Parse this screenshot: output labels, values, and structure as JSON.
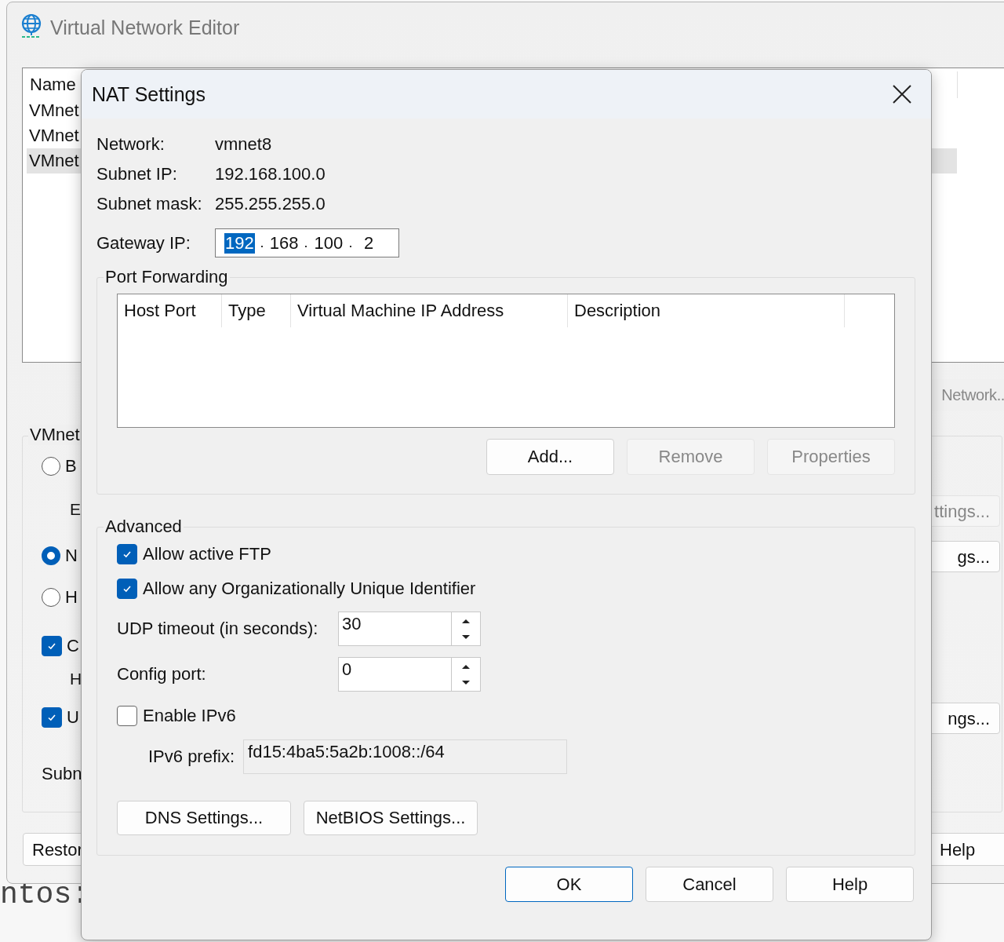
{
  "terminal_text": "ntos:",
  "background_window": {
    "title": "Virtual Network Editor",
    "network_list": {
      "column": "Name",
      "rows": [
        {
          "name": "VMnet",
          "selected": false
        },
        {
          "name": "VMnet",
          "selected": false
        },
        {
          "name": "VMnet",
          "selected": true
        }
      ]
    },
    "network_button": {
      "label": "Network..",
      "disabled": true
    },
    "group_label": "VMnet",
    "radios": [
      {
        "label": "B",
        "selected": false
      },
      {
        "label": "N",
        "selected": true
      },
      {
        "label": "H",
        "selected": false
      }
    ],
    "bridge_label": "E",
    "checkboxes": [
      {
        "label": "C",
        "checked": true
      },
      {
        "label": "U",
        "checked": true
      }
    ],
    "host_label": "H",
    "subnet_label": "Subn",
    "side_buttons": [
      {
        "label": "ttings...",
        "disabled": true
      },
      {
        "label": "gs...",
        "disabled": false
      },
      {
        "label": "ngs...",
        "disabled": false
      }
    ],
    "restore_button": "Restor",
    "help_button": "Help"
  },
  "nat_dialog": {
    "title": "NAT Settings",
    "info": [
      {
        "label": "Network:",
        "value": "vmnet8"
      },
      {
        "label": "Subnet IP:",
        "value": "192.168.100.0"
      },
      {
        "label": "Subnet mask:",
        "value": "255.255.255.0"
      }
    ],
    "gateway": {
      "label": "Gateway IP:",
      "octets": [
        {
          "value": "192",
          "selected": true
        },
        {
          "value": "168",
          "selected": false
        },
        {
          "value": "100",
          "selected": false
        },
        {
          "value": "2",
          "selected": false
        }
      ]
    },
    "port_forwarding": {
      "title": "Port Forwarding",
      "columns": [
        "Host Port",
        "Type",
        "Virtual Machine IP Address",
        "Description"
      ],
      "buttons": [
        {
          "label": "Add...",
          "disabled": false
        },
        {
          "label": "Remove",
          "disabled": true
        },
        {
          "label": "Properties",
          "disabled": true
        }
      ]
    },
    "advanced": {
      "title": "Advanced",
      "checkboxes": [
        {
          "label": "Allow active FTP",
          "checked": true
        },
        {
          "label": "Allow any Organizationally Unique Identifier",
          "checked": true
        }
      ],
      "spinners": [
        {
          "label": "UDP timeout (in seconds):",
          "value": "30"
        },
        {
          "label": "Config port:",
          "value": "0"
        }
      ],
      "ipv6": {
        "label": "Enable IPv6",
        "checked": false
      },
      "ipv6_prefix": {
        "label": "IPv6 prefix:",
        "value": "fd15:4ba5:5a2b:1008::/64",
        "disabled": true
      },
      "buttons": [
        "DNS Settings...",
        "NetBIOS Settings..."
      ]
    },
    "footer_buttons": [
      {
        "label": "OK",
        "default": true
      },
      {
        "label": "Cancel",
        "default": false
      },
      {
        "label": "Help",
        "default": false
      }
    ]
  }
}
